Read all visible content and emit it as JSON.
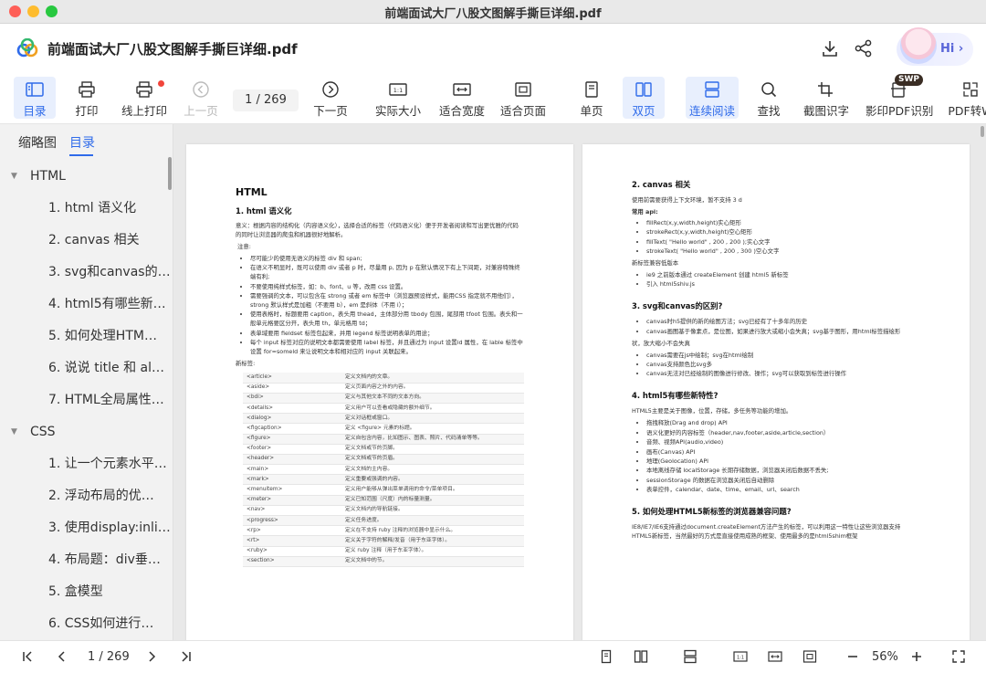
{
  "window": {
    "title": "前端面试大厂八股文图解手撕巨详细.pdf"
  },
  "header": {
    "doc_title": "前端面试大厂八股文图解手撕巨详细.pdf",
    "assistant_label": "Hi ›"
  },
  "toolbar": {
    "catalog": "目录",
    "print": "打印",
    "online_print": "线上打印",
    "prev_page": "上一页",
    "page_indicator": "1 / 269",
    "next_page": "下一页",
    "actual_size": "实际大小",
    "fit_width": "适合宽度",
    "fit_page": "适合页面",
    "single_page": "单页",
    "double_page": "双页",
    "continuous": "连续阅读",
    "find": "查找",
    "screenshot_ocr": "截图识字",
    "ocr_pdf": "影印PDF识别",
    "pdf_convert": "PDF转W",
    "swp_badge": "SWP"
  },
  "sidebar": {
    "tab_thumbnails": "缩略图",
    "tab_catalog": "目录",
    "tree": [
      {
        "label": "HTML",
        "level": 0
      },
      {
        "label": "1. html 语义化",
        "level": 1
      },
      {
        "label": "2. canvas 相关",
        "level": 1
      },
      {
        "label": "3. svg和canvas的…",
        "level": 1
      },
      {
        "label": "4. html5有哪些新…",
        "level": 1
      },
      {
        "label": "5. 如何处理HTM…",
        "level": 1
      },
      {
        "label": "6. 说说 title 和 al…",
        "level": 1
      },
      {
        "label": "7. HTML全局属性…",
        "level": 1
      },
      {
        "label": "CSS",
        "level": 0
      },
      {
        "label": "1. 让一个元素水平…",
        "level": 1
      },
      {
        "label": "2. 浮动布局的优…",
        "level": 1
      },
      {
        "label": "3. 使用display:inli…",
        "level": 1
      },
      {
        "label": "4. 布局题：div垂…",
        "level": 1
      },
      {
        "label": "5. 盒模型",
        "level": 1
      },
      {
        "label": "6. CSS如何进行…",
        "level": 1
      }
    ]
  },
  "page1": {
    "h1": "HTML",
    "h2": "1. html 语义化",
    "intro": "意义：根据内容的结构化（内容语义化），选择合适的标签（代码语义化）便于开发者阅读和写出更优雅的代码的同时让浏览器的爬虫和机器很好地解析。",
    "note_label": "注意:",
    "bullets": [
      "尽可能少的使用无语义的标签 div 和 span;",
      "在语义不明显时，既可以使用 div 或者 p 时，尽量用 p, 因为 p 在默认情况下有上下间距，对兼容特殊终端有利;",
      "不要使用纯样式标签，如：b、font、u 等，改用 css 设置。",
      "需要强调的文本，可以包含在 strong 或者 em 标签中（浏览器预设样式，能用CSS 指定就不用他们），strong 默认样式是加粗（不要用 b），em 是斜体（不用 i）；",
      "使用表格时，标题要用 caption，表头用 thead，主体部分用 tbody 包围，尾部用 tfoot 包围。表头和一般单元格要区分开，表头用 th，单元格用 td；",
      "表单域要用 fieldset 标签包起来，并用 legend 标签说明表单的用途；",
      "每个 input 标签对应的说明文本都需要使用 label 标签，并且通过为 input 设置id 属性，在 lable 标签中设置 for=someld 来让说明文本和相对应的 input 关联起来。"
    ],
    "new_tags_label": "新标签:",
    "tags": [
      [
        "<article>",
        "定义文档内的文章。"
      ],
      [
        "<aside>",
        "定义页面内容之外的内容。"
      ],
      [
        "<bdi>",
        "定义与其他文本不同的文本方向。"
      ],
      [
        "<details>",
        "定义用户可以查看或隐藏的额外细节。"
      ],
      [
        "<dialog>",
        "定义对话框或窗口。"
      ],
      [
        "<figcaption>",
        "定义 <figure> 元素的标题。"
      ],
      [
        "<figure>",
        "定义自包含内容，比如图示、图表、照片、代码清单等等。"
      ],
      [
        "<footer>",
        "定义文档或节的页脚。"
      ],
      [
        "<header>",
        "定义文档或节的页眉。"
      ],
      [
        "<main>",
        "定义文档的主内容。"
      ],
      [
        "<mark>",
        "定义重要或强调的内容。"
      ],
      [
        "<menuitem>",
        "定义用户能够从弹出菜单调用的命令/菜单项目。"
      ],
      [
        "<meter>",
        "定义已知范围（尺度）内的标量测量。"
      ],
      [
        "<nav>",
        "定义文档内的导航链接。"
      ],
      [
        "<progress>",
        "定义任务进度。"
      ],
      [
        "<rp>",
        "定义在不支持 ruby 注释的浏览器中显示什么。"
      ],
      [
        "<rt>",
        "定义关于字符的解释/发音（用于东亚字体）。"
      ],
      [
        "<ruby>",
        "定义 ruby 注释（用于东亚字体）。"
      ],
      [
        "<section>",
        "定义文档中的节。"
      ]
    ]
  },
  "page2": {
    "s2_title": "2. canvas 相关",
    "s2_intro": "使用前需要获得上下文环境，暂不支持 3 d",
    "s2_api_label": "常用 api:",
    "s2_api": [
      "fillRect(x,y,width,height)实心矩形",
      "strokeRect(x,y,width,height)空心矩形",
      "fillText( \"Hello world\" , 200 , 200 );实心文字",
      "strokeText( \"Hello world\" , 200 , 300 )空心文字"
    ],
    "s2_compat_label": "新标签兼容低版本",
    "s2_compat": [
      "ie9 之前版本通过 createElement 创建 html5 新标签",
      "引入 html5shiv.js"
    ],
    "s3_title": "3. svg和canvas的区别?",
    "s3_b1": [
      "canvas时h5提供的新的绘图方法；svg已经有了十多年的历史",
      "canvas画图基于像素点，是位图，如果进行放大或缩小会失真；svg基于图形，用html标签描绘形"
    ],
    "s3_cont": "状，放大缩小不会失真",
    "s3_b2": [
      "canvas需要在js中绘制；svg在html绘制",
      "canvas支持颜色比svg多",
      "canvas无法对已经绘制的图像进行修改、操作；svg可以获取到标签进行操作"
    ],
    "s4_title": "4. html5有哪些新特性?",
    "s4_intro": "HTML5主要是关于图像，位置，存储，多任务等功能的增加。",
    "s4_items": [
      "拖拽释放(Drag and drop) API",
      "语义化更好的内容标签（header,nav,footer,aside,article,section）",
      "音频、视频API(audio,video)",
      "画布(Canvas) API",
      "地理(Geolocation) API",
      "本地离线存储 localStorage 长期存储数据，浏览器关闭后数据不丢失;",
      "sessionStorage 的数据在浏览器关闭后自动删除",
      "表单控件，calendar、date、time、email、url、search"
    ],
    "s5_title": "5. 如何处理HTML5新标签的浏览器兼容问题?",
    "s5_text": "IE8/IE7/IE6支持通过document.createElement方法产生的标签，可以利用这一特性让这些浏览器支持HTML5新标签，当然最好的方式是直接使用成熟的框架、使用最多的是html5shim框架"
  },
  "bottombar": {
    "page_indicator": "1 / 269",
    "zoom": "56%"
  },
  "colors": {
    "accent": "#2f6bea",
    "active_bg": "#e8effd"
  }
}
